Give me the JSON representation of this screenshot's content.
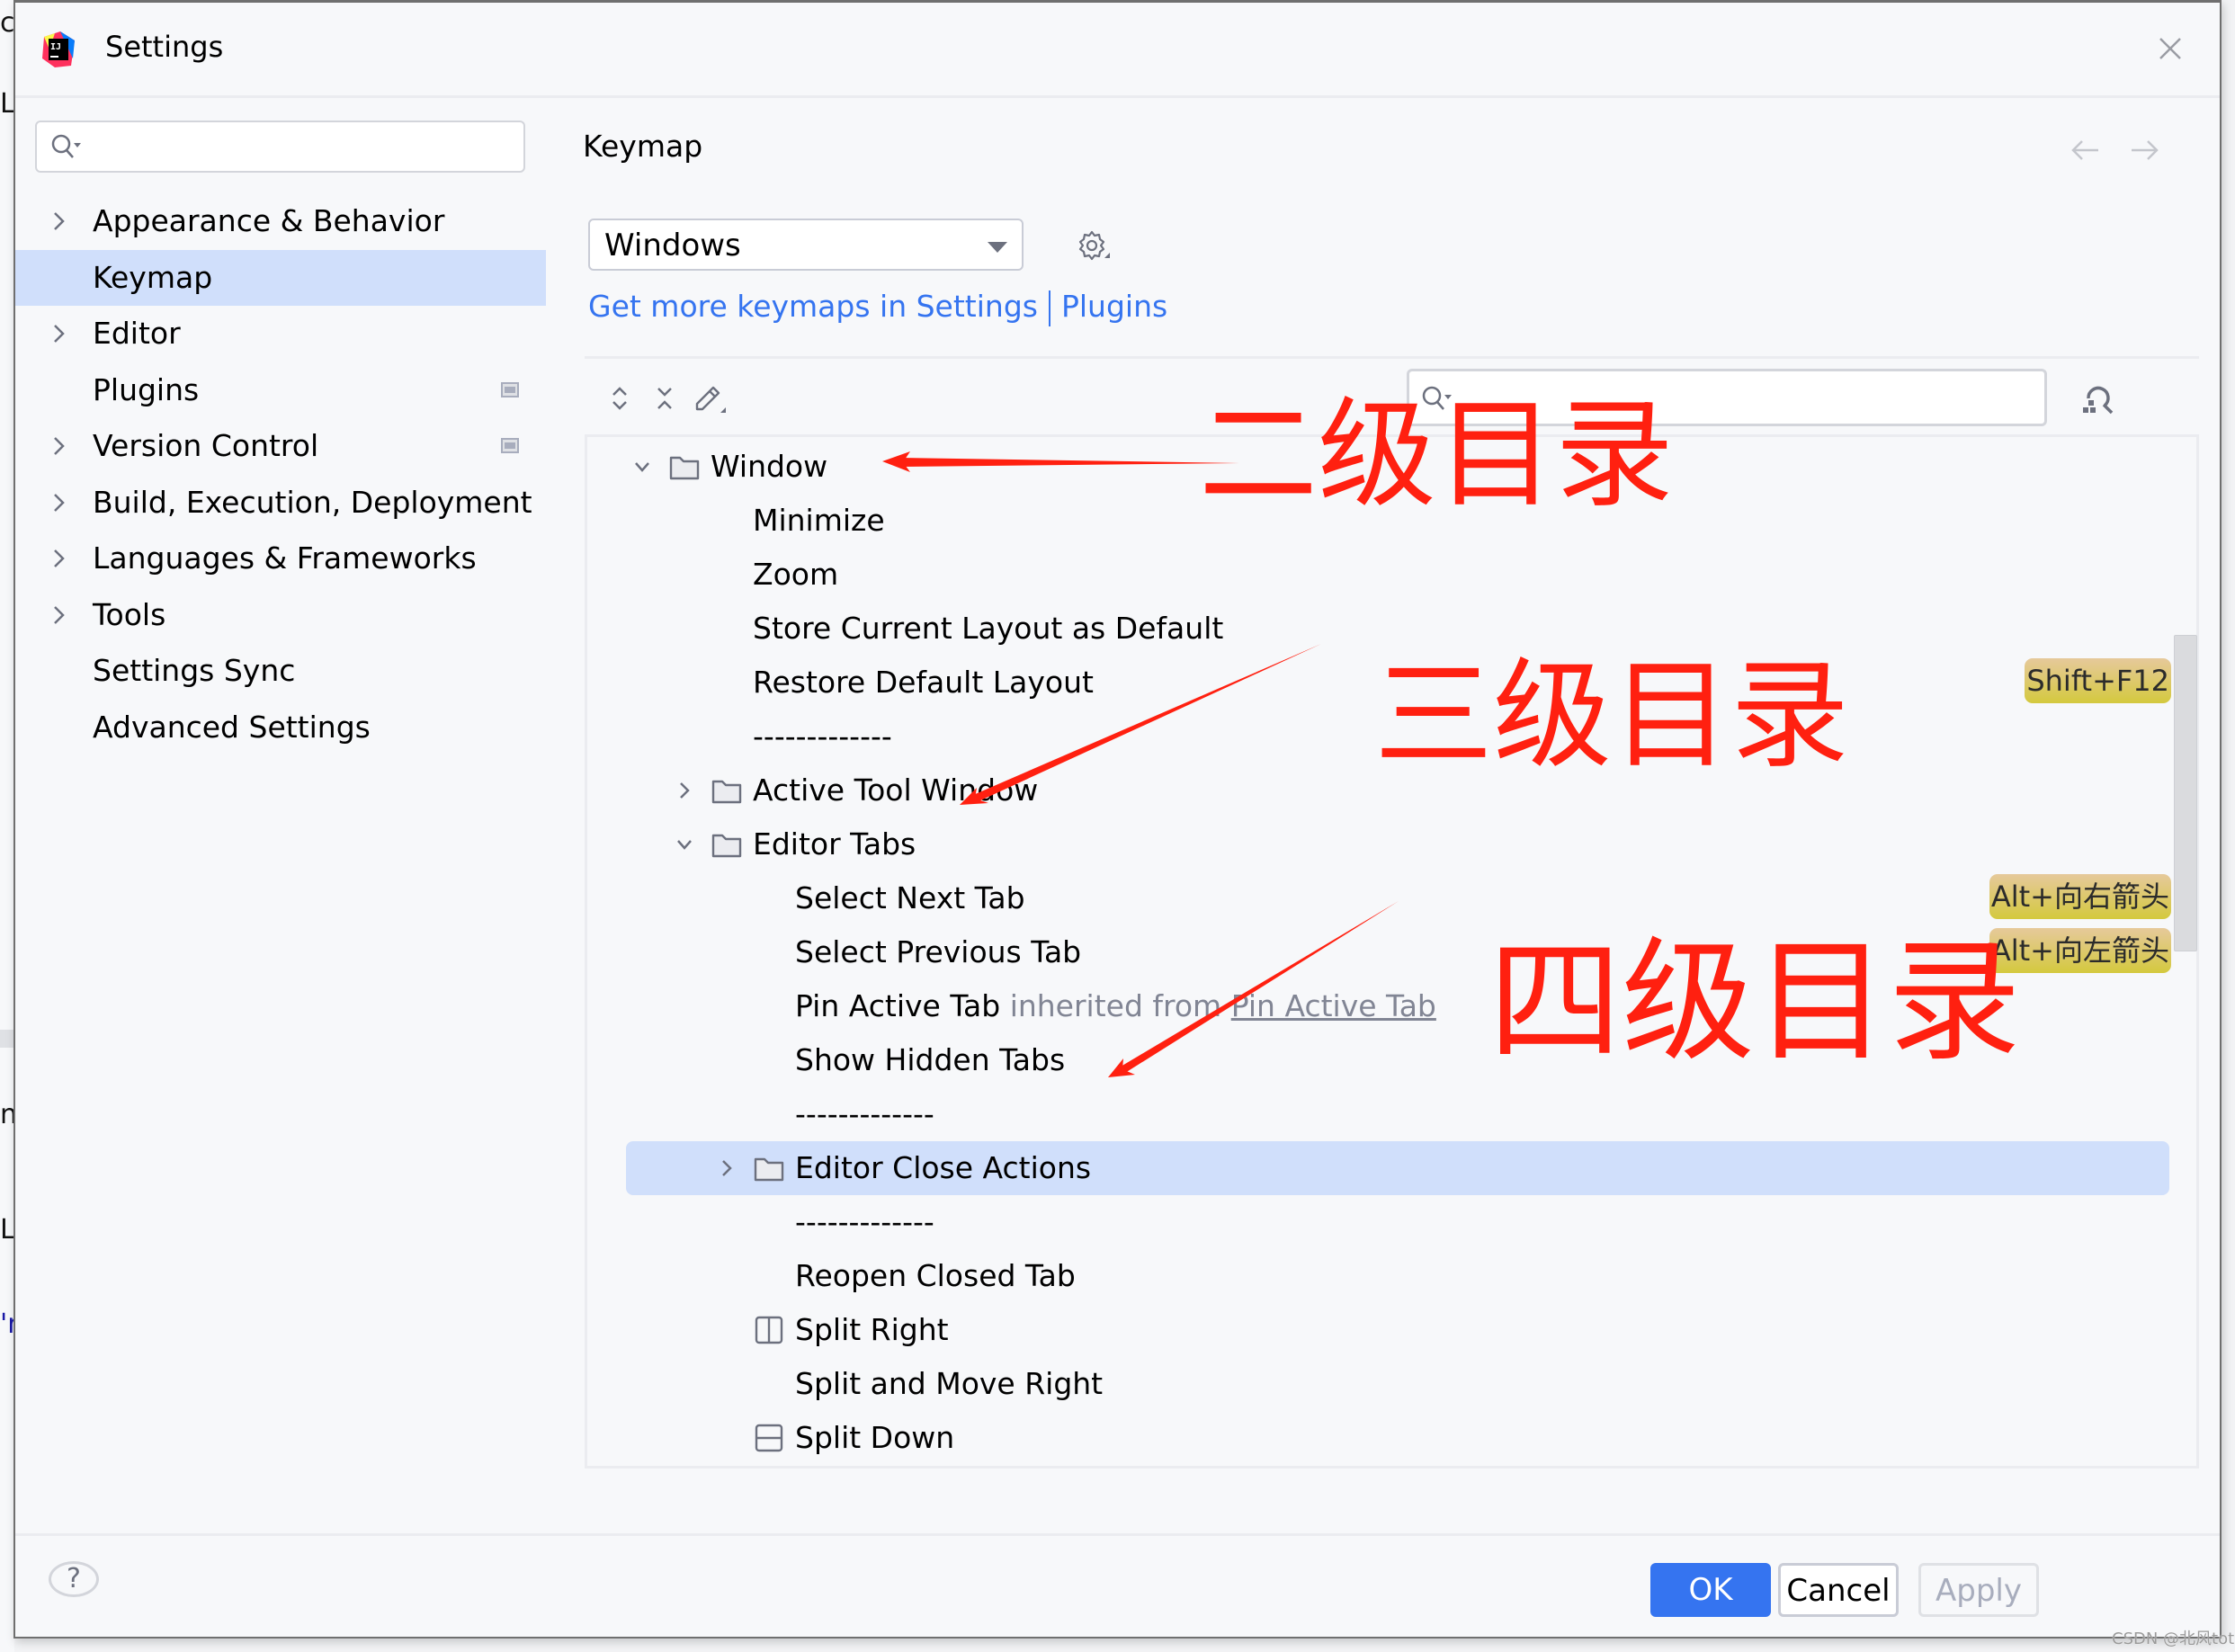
{
  "background_ide": {
    "fragments": [
      "ct",
      "L",
      "n",
      "L",
      "'r"
    ]
  },
  "dialog": {
    "title": "Settings",
    "app_icon": "intellij-idea-logo",
    "close_icon": "close-icon"
  },
  "sidebar": {
    "search": {
      "value": "",
      "placeholder": ""
    },
    "items": [
      {
        "label": "Appearance & Behavior",
        "expandable": true,
        "selected": false,
        "badge": false
      },
      {
        "label": "Keymap",
        "expandable": false,
        "selected": true,
        "badge": false
      },
      {
        "label": "Editor",
        "expandable": true,
        "selected": false,
        "badge": false
      },
      {
        "label": "Plugins",
        "expandable": false,
        "selected": false,
        "badge": true
      },
      {
        "label": "Version Control",
        "expandable": true,
        "selected": false,
        "badge": true
      },
      {
        "label": "Build, Execution, Deployment",
        "expandable": true,
        "selected": false,
        "badge": false
      },
      {
        "label": "Languages & Frameworks",
        "expandable": true,
        "selected": false,
        "badge": false
      },
      {
        "label": "Tools",
        "expandable": true,
        "selected": false,
        "badge": false
      },
      {
        "label": "Settings Sync",
        "expandable": false,
        "selected": false,
        "badge": false
      },
      {
        "label": "Advanced Settings",
        "expandable": false,
        "selected": false,
        "badge": false
      }
    ]
  },
  "main": {
    "title": "Keymap",
    "keymap_select": {
      "value": "Windows"
    },
    "links": {
      "prefix": "Get more keymaps in Settings",
      "plugins": "Plugins"
    },
    "toolbar": {
      "expand_all": "expand-all-icon",
      "collapse_all": "collapse-all-icon",
      "edit": "edit-icon"
    },
    "action_search": {
      "value": "",
      "placeholder": ""
    },
    "tree": [
      {
        "label": "Window",
        "level": 1,
        "type": "folder",
        "expanded": true
      },
      {
        "label": "Minimize",
        "level": 2,
        "type": "action"
      },
      {
        "label": "Zoom",
        "level": 2,
        "type": "action"
      },
      {
        "label": "Store Current Layout as Default",
        "level": 2,
        "type": "action"
      },
      {
        "label": "Restore Default Layout",
        "level": 2,
        "type": "action",
        "shortcut": "Shift+F12"
      },
      {
        "label": "-------------",
        "level": 2,
        "type": "separator"
      },
      {
        "label": "Active Tool Window",
        "level": 2,
        "type": "folder",
        "expanded": false
      },
      {
        "label": "Editor Tabs",
        "level": 2,
        "type": "folder",
        "expanded": true
      },
      {
        "label": "Select Next Tab",
        "level": 3,
        "type": "action",
        "shortcut": "Alt+向右箭头"
      },
      {
        "label": "Select Previous Tab",
        "level": 3,
        "type": "action",
        "shortcut": "Alt+向左箭头"
      },
      {
        "label": "Pin Active Tab",
        "level": 3,
        "type": "action",
        "inherited_text": "inherited from",
        "inherited_link": "Pin Active Tab"
      },
      {
        "label": "Show Hidden Tabs",
        "level": 3,
        "type": "action"
      },
      {
        "label": "-------------",
        "level": 3,
        "type": "separator"
      },
      {
        "label": "Editor Close Actions",
        "level": 3,
        "type": "folder",
        "expanded": false,
        "selected": true
      },
      {
        "label": "-------------",
        "level": 3,
        "type": "separator"
      },
      {
        "label": "Reopen Closed Tab",
        "level": 3,
        "type": "action"
      },
      {
        "label": "Split Right",
        "level": 3,
        "type": "action",
        "icon": "split-vertical-icon"
      },
      {
        "label": "Split and Move Right",
        "level": 3,
        "type": "action"
      },
      {
        "label": "Split Down",
        "level": 3,
        "type": "action",
        "icon": "split-horizontal-icon"
      }
    ]
  },
  "footer": {
    "help": "?",
    "ok": "OK",
    "cancel": "Cancel",
    "apply": "Apply"
  },
  "annotations": {
    "level2": "二级目录",
    "level3": "三级目录",
    "level4": "四级目录",
    "color": "#ff2010"
  },
  "watermark": "CSDN @北风toto",
  "colors": {
    "accent": "#3574f0",
    "selection": "#d0dffb",
    "shortcut_badge": "#d4c93e"
  }
}
